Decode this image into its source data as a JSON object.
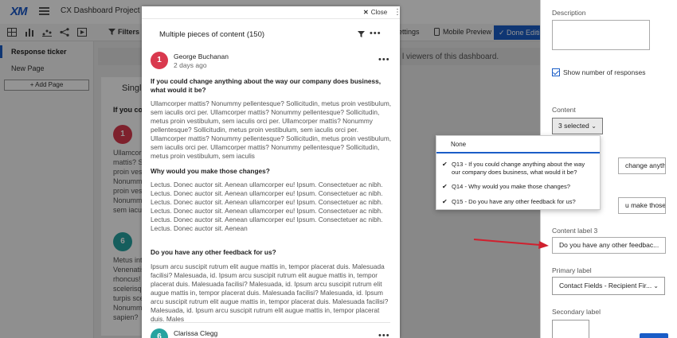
{
  "app": {
    "logo": "XM",
    "title": "CX Dashboard Project",
    "toolbar": {
      "filters_label": "Filters",
      "settings_label": "ettings",
      "preview_label": "Mobile Preview",
      "done_label": "✓ Done Editi"
    },
    "nav": {
      "active_item": "Response ticker",
      "item": "New Page",
      "add_page": "+ Add Page"
    },
    "banner_text": "l viewers of this dashboard.",
    "widget": {
      "title": "Single",
      "question": "If you co",
      "avatar1_letter": "1",
      "avatar2_letter": "6",
      "body1": "Ullamcorper\nmattis? Sed\nproin vestib\nNonummy\nproin vestib\nNonummy\nsem iaculis",
      "body2": "Metus inter\nVenenatis\nrhoncus! V\nscelerisque\nturpis sce\nNonummy\nsapien?"
    }
  },
  "modal": {
    "close_label": "Close",
    "heading": "Multiple pieces of content (150)",
    "responses": [
      {
        "avatar_letter": "1",
        "avatar_color": "#d9394e",
        "name": "George Buchanan",
        "date": "2 days ago",
        "q1": "If you could change anything about the way our company does business, what would it be?",
        "a1": "Ullamcorper mattis? Nonummy pellentesque? Sollicitudin, metus proin vestibulum, sem iaculis orci per. Ullamcorper mattis? Nonummy pellentesque? Sollicitudin, metus proin vestibulum, sem iaculis orci per. Ullamcorper mattis? Nonummy pellentesque? Sollicitudin, metus proin vestibulum, sem iaculis orci per. Ullamcorper mattis? Nonummy pellentesque? Sollicitudin, metus proin vestibulum, sem iaculis orci per. Ullamcorper mattis? Nonummy pellentesque? Sollicitudin, metus proin vestibulum, sem iaculis",
        "q2": "Why would you make those changes?",
        "a2": "Lectus. Donec auctor sit. Aenean ullamcorper eu! Ipsum. Consectetuer ac nibh. Lectus. Donec auctor sit. Aenean ullamcorper eu! Ipsum. Consectetuer ac nibh. Lectus. Donec auctor sit. Aenean ullamcorper eu! Ipsum. Consectetuer ac nibh. Lectus. Donec auctor sit. Aenean ullamcorper eu! Ipsum. Consectetuer ac nibh. Lectus. Donec auctor sit. Aenean ullamcorper eu! Ipsum. Consectetuer ac nibh. Lectus. Donec auctor sit. Aenean",
        "q3": "Do you have any other feedback for us?",
        "a3": "Ipsum arcu suscipit rutrum elit augue mattis in, tempor placerat duis. Malesuada facilisi? Malesuada, id. Ipsum arcu suscipit rutrum elit augue mattis in, tempor placerat duis. Malesuada facilisi? Malesuada, id. Ipsum arcu suscipit rutrum elit augue mattis in, tempor placerat duis. Malesuada facilisi? Malesuada, id. Ipsum arcu suscipit rutrum elit augue mattis in, tempor placerat duis. Malesuada facilisi? Malesuada, id. Ipsum arcu suscipit rutrum elit augue mattis in, tempor placerat duis. Males"
      },
      {
        "avatar_letter": "6",
        "avatar_color": "#27a3a0",
        "name": "Clarissa Clegg"
      }
    ]
  },
  "panel": {
    "description_label": "Description",
    "show_responses_label": "Show number of responses",
    "content_label": "Content",
    "content_value": "3 selected",
    "content_label_1_value": "change anything a...",
    "content_label_2_value": "u make those ch...",
    "content_label_3": "Content label 3",
    "content_label_3_value": "Do you have any other feedbac...",
    "primary_label": "Primary label",
    "primary_value": "Contact Fields - Recipient Fir...",
    "secondary_label": "Secondary label"
  },
  "dropdown": {
    "none_label": "None",
    "options": [
      {
        "checked": true,
        "label": "Q13 - If you could change anything about the way our company does business, what would it be?"
      },
      {
        "checked": true,
        "label": "Q14 - Why would you make those changes?"
      },
      {
        "checked": true,
        "label": "Q15 - Do you have any other feedback for us?"
      }
    ]
  },
  "colors": {
    "accent": "#1a5dc7",
    "arrow": "#d0202e"
  }
}
